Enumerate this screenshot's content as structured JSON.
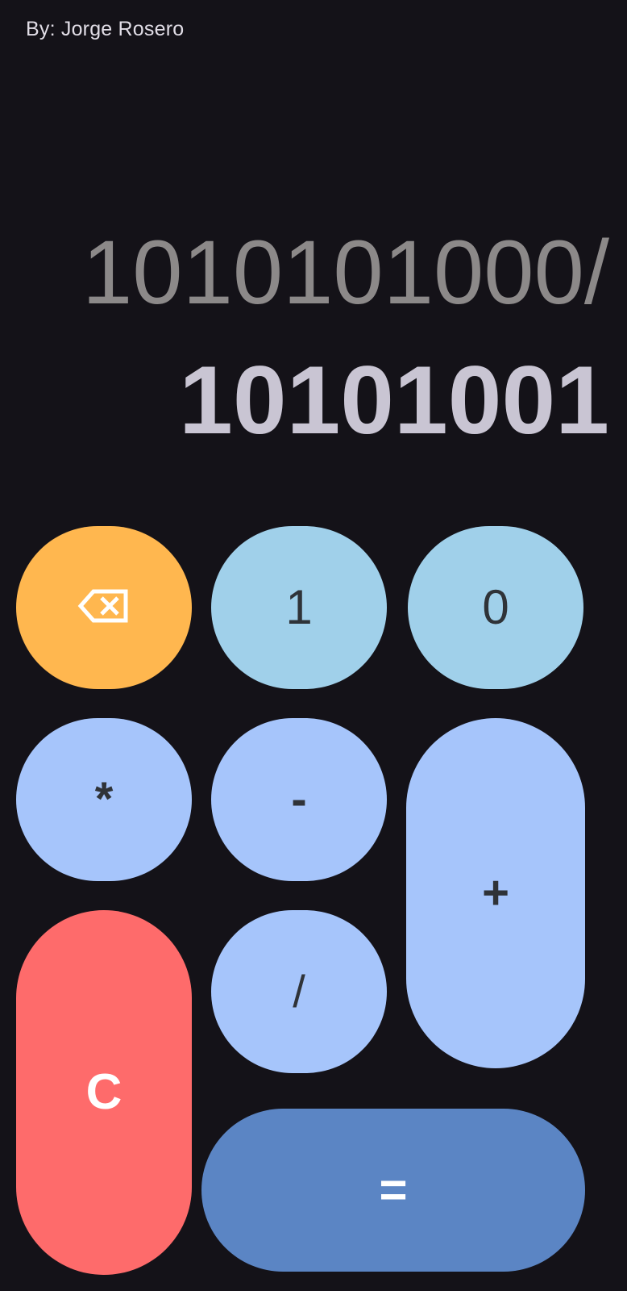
{
  "header": {
    "author": "By: Jorge Rosero"
  },
  "display": {
    "expression": "1010101000/",
    "result": "10101001"
  },
  "keys": {
    "backspace": {
      "icon": "backspace-icon",
      "color": "#ffb74f"
    },
    "one": {
      "label": "1",
      "color": "#a0d0ea"
    },
    "zero": {
      "label": "0",
      "color": "#a0d0ea"
    },
    "multiply": {
      "label": "*",
      "color": "#a6c5fb"
    },
    "minus": {
      "label": "-",
      "color": "#a6c5fb"
    },
    "plus": {
      "label": "+",
      "color": "#a6c5fb"
    },
    "divide": {
      "label": "/",
      "color": "#a6c5fb"
    },
    "clear": {
      "label": "C",
      "color": "#fe6b6b"
    },
    "equals": {
      "label": "=",
      "color": "#5b85c4"
    }
  },
  "colors": {
    "background": "#141218",
    "expression_text": "#8c8989",
    "result_text": "#c9c5d3"
  }
}
